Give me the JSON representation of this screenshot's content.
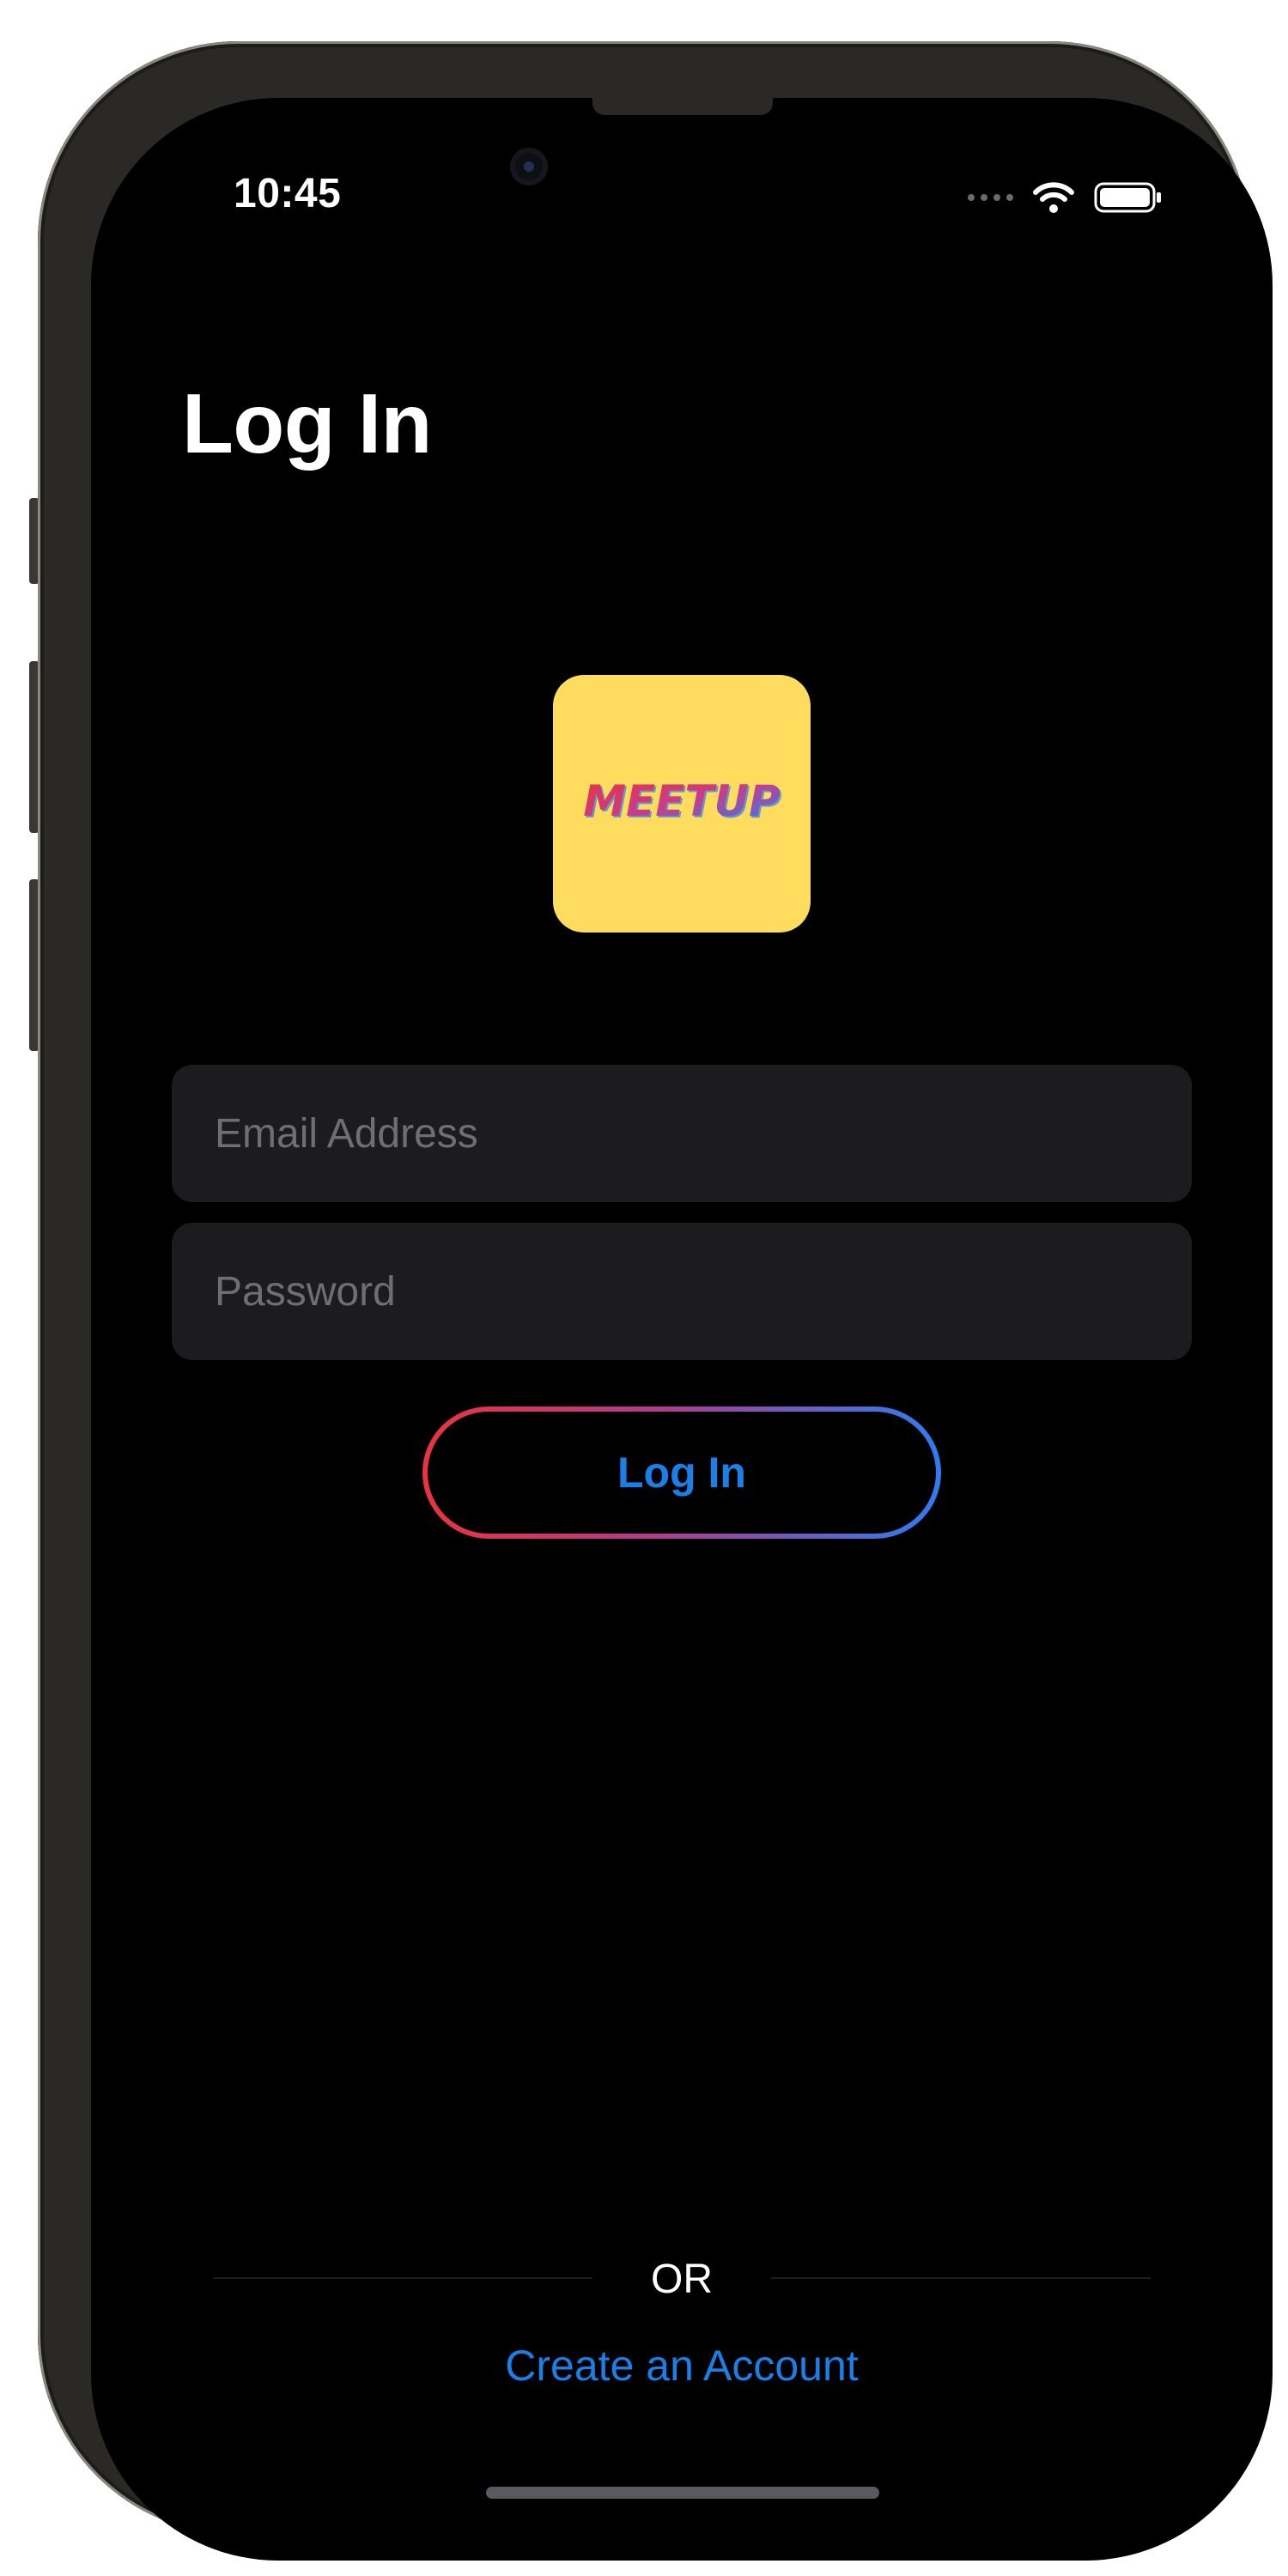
{
  "status_bar": {
    "time": "10:45",
    "icons": [
      "cellular-signal-icon",
      "wifi-icon",
      "battery-icon"
    ]
  },
  "header": {
    "title": "Log In"
  },
  "logo": {
    "text": "MEETUP",
    "background": "#FEDC5E",
    "text_gradient": [
      "#E8343F",
      "#B03C8C",
      "#2D7CF0"
    ]
  },
  "form": {
    "email_placeholder": "Email Address",
    "email_value": "",
    "password_placeholder": "Password",
    "password_value": "",
    "submit_label": "Log In"
  },
  "footer": {
    "divider_text": "OR",
    "create_account_label": "Create an Account"
  },
  "colors": {
    "background": "#000000",
    "accent": "#1B7FE8",
    "field": "#1C1C1E"
  }
}
